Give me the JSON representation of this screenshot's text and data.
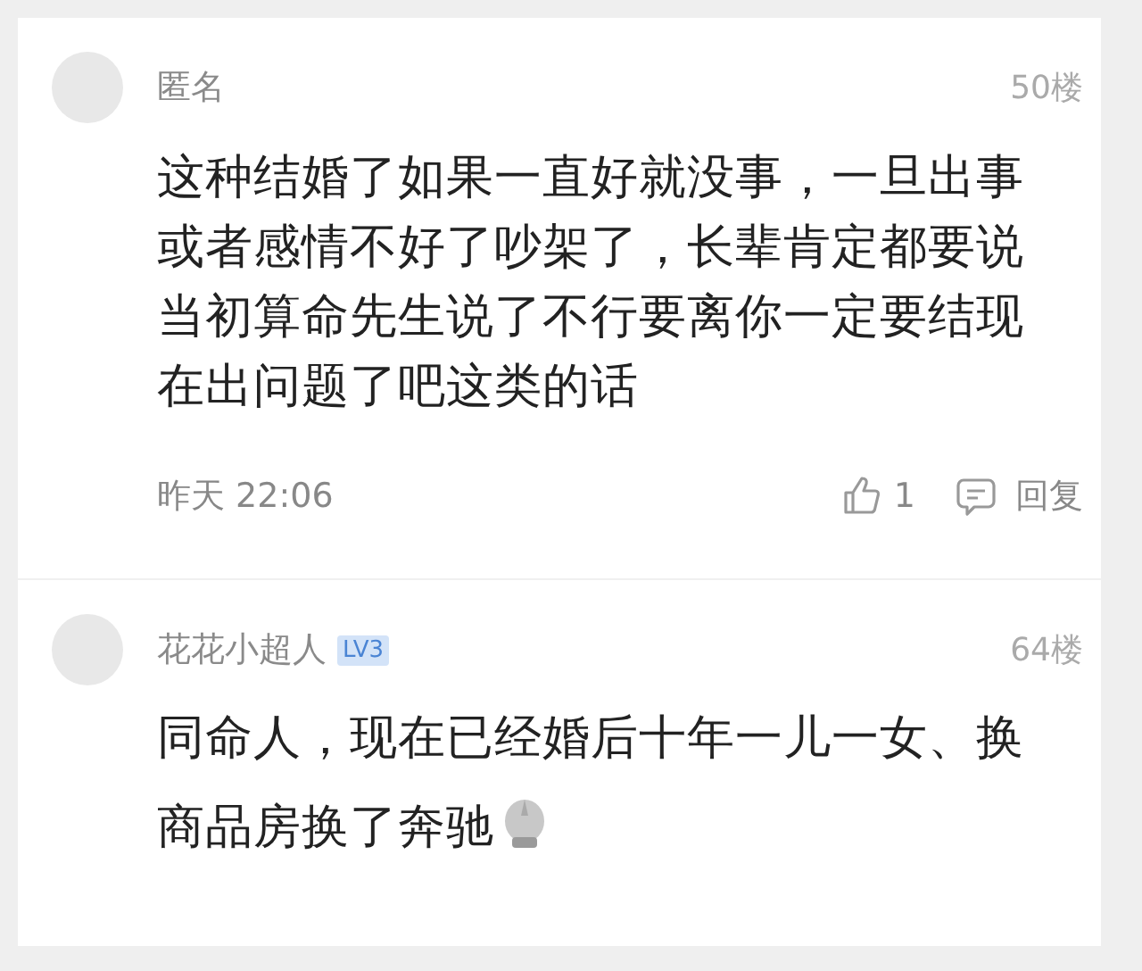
{
  "comments": [
    {
      "author": "匿名",
      "floor": "50楼",
      "text": "这种结婚了如果一直好就没事，一旦出事或者感情不好了吵架了，长辈肯定都要说当初算命先生说了不行要离你一定要结现在出问题了吧这类的话",
      "time": "昨天 22:06",
      "likes": "1",
      "reply": "回复"
    },
    {
      "author": "花花小超人",
      "badge": "LV3",
      "floor": "64楼",
      "text": "同命人，现在已经婚后十年一儿一女、换商品房换了奔驰",
      "emoji": true
    }
  ]
}
